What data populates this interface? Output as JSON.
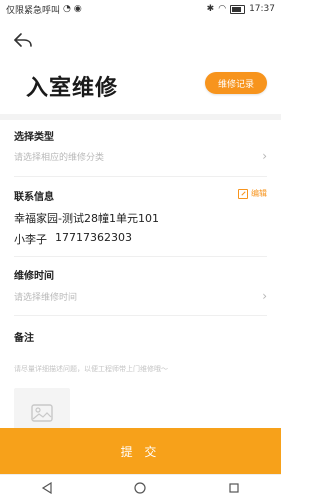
{
  "status_bar": {
    "left_text": "仅限紧急呼叫",
    "time": "17:37"
  },
  "header": {
    "title": "入室维修",
    "record_button": "维修记录"
  },
  "repair_type": {
    "title": "选择类型",
    "placeholder": "请选择相应的维修分类"
  },
  "contact": {
    "title": "联系信息",
    "edit_label": "编辑",
    "address": "幸福家园-测试28幢1单元101",
    "name": "小李子",
    "phone": "17717362303"
  },
  "repair_time": {
    "title": "维修时间",
    "placeholder": "请选择维修时间"
  },
  "notes": {
    "title": "备注",
    "placeholder": "请尽量详细描述问题，以便工程师带上门维修哦～"
  },
  "submit": {
    "label": "提 交"
  },
  "colors": {
    "accent": "#f7941d",
    "submit": "#f7a11a"
  }
}
